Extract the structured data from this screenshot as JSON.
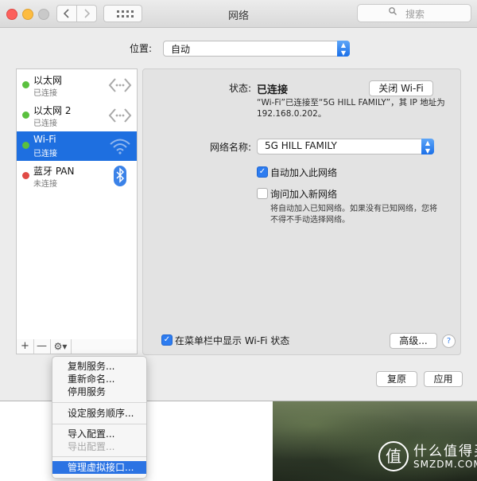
{
  "window": {
    "title": "网络",
    "search_placeholder": "搜索"
  },
  "location": {
    "label": "位置:",
    "value": "自动"
  },
  "services": [
    {
      "name": "以太网",
      "status": "已连接",
      "dot": "#5ac03e",
      "icon": "ethernet-icon",
      "selected": false
    },
    {
      "name": "以太网 2",
      "status": "已连接",
      "dot": "#5ac03e",
      "icon": "ethernet-icon",
      "selected": false
    },
    {
      "name": "Wi-Fi",
      "status": "已连接",
      "dot": "#5ac03e",
      "icon": "wifi-icon",
      "selected": true
    },
    {
      "name": "蓝牙 PAN",
      "status": "未连接",
      "dot": "#e04a45",
      "icon": "bluetooth-icon",
      "selected": false
    }
  ],
  "list_toolbar": {
    "add": "+",
    "remove": "—",
    "gear": "⚙▾"
  },
  "detail": {
    "status_label": "状态:",
    "status_value": "已连接",
    "turn_off_button": "关闭 Wi-Fi",
    "status_desc": "“Wi-Fi”已连接至“5G HILL FAMILY”，其 IP 地址为 192.168.0.202。",
    "network_name_label": "网络名称:",
    "network_name_value": "5G HILL FAMILY",
    "auto_join_label": "自动加入此网络",
    "auto_join_checked": true,
    "ask_join_label": "询问加入新网络",
    "ask_join_checked": false,
    "ask_join_note": "将自动加入已知网络。如果没有已知网络，您将不得不手动选择网络。",
    "menubar_label": "在菜单栏中显示 Wi-Fi 状态",
    "menubar_checked": true,
    "advanced_button": "高级...",
    "help_button": "?"
  },
  "footer": {
    "revert_button": "复原",
    "apply_button": "应用"
  },
  "context_menu": {
    "items": [
      {
        "label": "复制服务...",
        "disabled": false
      },
      {
        "label": "重新命名...",
        "disabled": false
      },
      {
        "label": "停用服务",
        "disabled": false
      },
      {
        "label": "设定服务顺序...",
        "disabled": false
      },
      {
        "label": "导入配置...",
        "disabled": false
      },
      {
        "label": "导出配置...",
        "disabled": true
      },
      {
        "label": "管理虚拟接口...",
        "disabled": false
      }
    ]
  },
  "watermark": {
    "glyph": "值",
    "title": "什么值得买",
    "subtitle": "SMZDM.COM"
  },
  "colors": {
    "accent": "#1e6fe0",
    "connected": "#5ac03e",
    "disconnected": "#e04a45"
  }
}
